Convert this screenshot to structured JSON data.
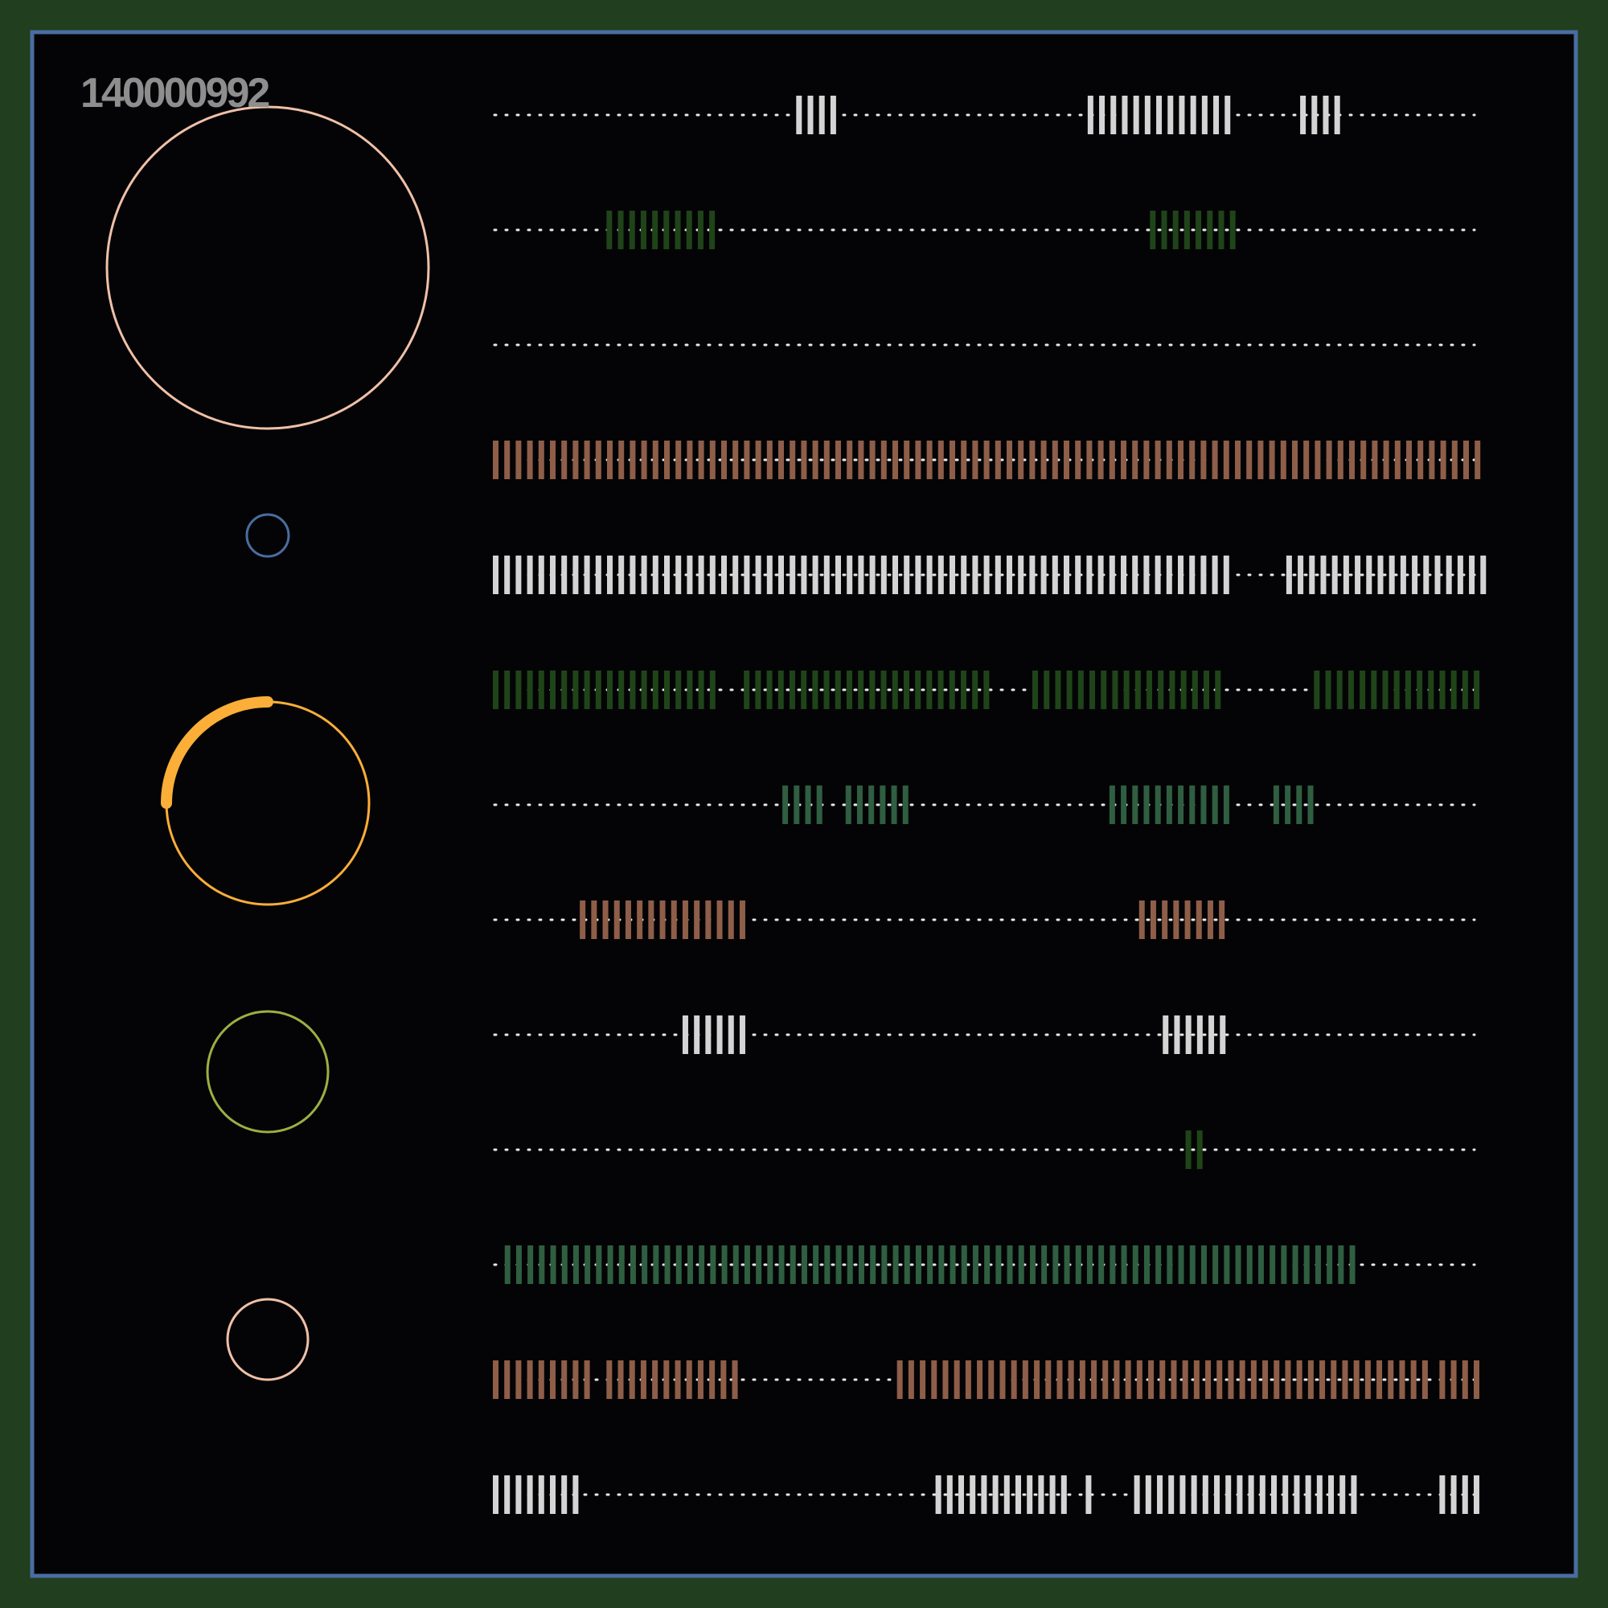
{
  "page": {
    "background": "#213e1e",
    "panel_background": "#040406",
    "panel_border": "#4a6da0",
    "label": "140000992"
  },
  "circles": [
    {
      "name": "large-peach-circle",
      "color": "#f0c0a8",
      "progress": null
    },
    {
      "name": "small-blue-circle",
      "color": "#4a6da0",
      "progress": null
    },
    {
      "name": "orange-progress-circle",
      "color": "#fbae38",
      "progress": 0.25
    },
    {
      "name": "olive-circle",
      "color": "#9bb043",
      "progress": null
    },
    {
      "name": "peach-circle",
      "color": "#f0c0a8",
      "progress": null
    }
  ],
  "tracks": [
    {
      "color": "#d4d4d4",
      "segments": [
        [
          0.307,
          0.35
        ],
        [
          0.602,
          0.746
        ],
        [
          0.817,
          0.852
        ]
      ]
    },
    {
      "color": "#1f4419",
      "segments": [
        [
          0.115,
          0.225
        ],
        [
          0.665,
          0.746
        ]
      ]
    },
    {
      "color": "#d4d4d4",
      "segments": []
    },
    {
      "color": "#8e5e49",
      "segments": [
        [
          0.0,
          1.0
        ]
      ]
    },
    {
      "color": "#d4d4d4",
      "segments": [
        [
          0.0,
          0.746
        ],
        [
          0.803,
          1.0
        ]
      ]
    },
    {
      "color": "#1f4419",
      "segments": [
        [
          0.0,
          0.225
        ],
        [
          0.254,
          0.505
        ],
        [
          0.546,
          0.733
        ],
        [
          0.831,
          1.0
        ]
      ]
    },
    {
      "color": "#2f5e41",
      "segments": [
        [
          0.293,
          0.336
        ],
        [
          0.357,
          0.415
        ],
        [
          0.624,
          0.746
        ],
        [
          0.79,
          0.835
        ]
      ]
    },
    {
      "color": "#8e5e49",
      "segments": [
        [
          0.088,
          0.25
        ],
        [
          0.654,
          0.746
        ]
      ]
    },
    {
      "color": "#d4d4d4",
      "segments": [
        [
          0.192,
          0.25
        ],
        [
          0.678,
          0.746
        ]
      ]
    },
    {
      "color": "#1f4419",
      "segments": [
        [
          0.701,
          0.721
        ]
      ]
    },
    {
      "color": "#2f5e41",
      "segments": [
        [
          0.012,
          0.874
        ]
      ]
    },
    {
      "color": "#8e5e49",
      "segments": [
        [
          0.0,
          0.097
        ],
        [
          0.115,
          0.25
        ],
        [
          0.409,
          0.941
        ],
        [
          0.958,
          1.0
        ]
      ]
    },
    {
      "color": "#d4d4d4",
      "segments": [
        [
          0.0,
          0.083
        ],
        [
          0.448,
          0.583
        ],
        [
          0.6,
          0.605
        ],
        [
          0.649,
          0.874
        ],
        [
          0.958,
          1.0
        ]
      ]
    }
  ]
}
